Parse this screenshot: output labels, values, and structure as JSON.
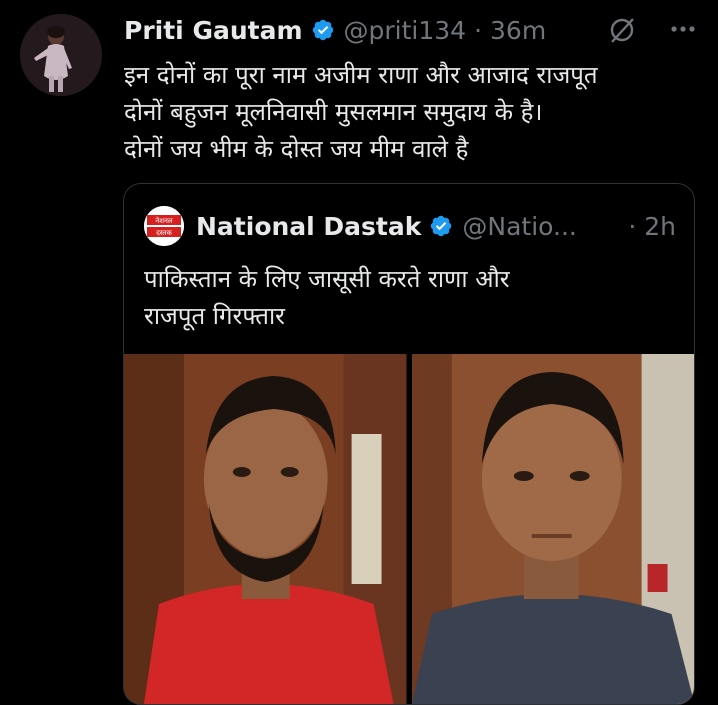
{
  "tweet": {
    "author_name": "Priti Gautam",
    "handle": "@priti134",
    "separator": "·",
    "time": "36m",
    "text": "इन दोनों का पूरा नाम अजीम राणा और आजाद राजपूत\nदोनों बहुजन मूलनिवासी मुसलमान समुदाय के है।\nदोनों जय भीम के दोस्त जय मीम वाले है"
  },
  "quote": {
    "author_name": "National Dastak",
    "handle": "@Natio...",
    "separator": "·",
    "time": "2h",
    "text": "पाकिस्तान के लिए जासूसी करते राणा और\nराजपूत गिरफ्तार",
    "logo_text_top": "नेशनल",
    "logo_text_bottom": "दस्तक"
  },
  "colors": {
    "background": "#000000",
    "text_primary": "#e7e9ea",
    "text_secondary": "#71767b",
    "verified": "#1d9bf0",
    "border": "#2f3336"
  },
  "icons": {
    "verified": "verified-badge-icon",
    "grok": "grok-icon",
    "more": "more-options-icon"
  }
}
